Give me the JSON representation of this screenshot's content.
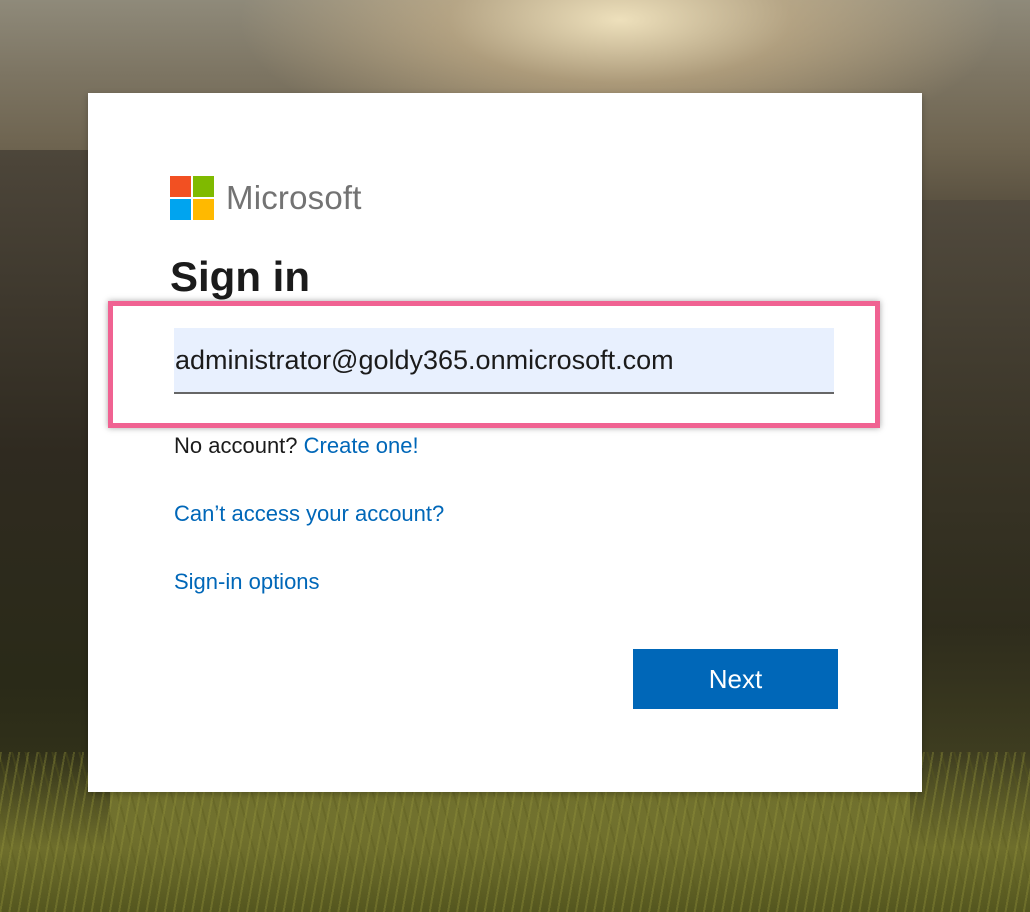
{
  "brand": {
    "name": "Microsoft",
    "logo_colors": {
      "red": "#f25022",
      "green": "#7fba00",
      "blue": "#00a4ef",
      "yellow": "#ffb900"
    }
  },
  "form": {
    "title": "Sign in",
    "email_value": "administrator@goldy365.onmicrosoft.com",
    "no_account_text": "No account?",
    "create_link": "Create one!",
    "cant_access_link": "Can’t access your account?",
    "signin_options_link": "Sign-in options",
    "next_label": "Next"
  },
  "colors": {
    "link": "#0067b8",
    "button": "#0067b8",
    "highlight": "#f06292",
    "input_bg": "#e8f0fe"
  }
}
